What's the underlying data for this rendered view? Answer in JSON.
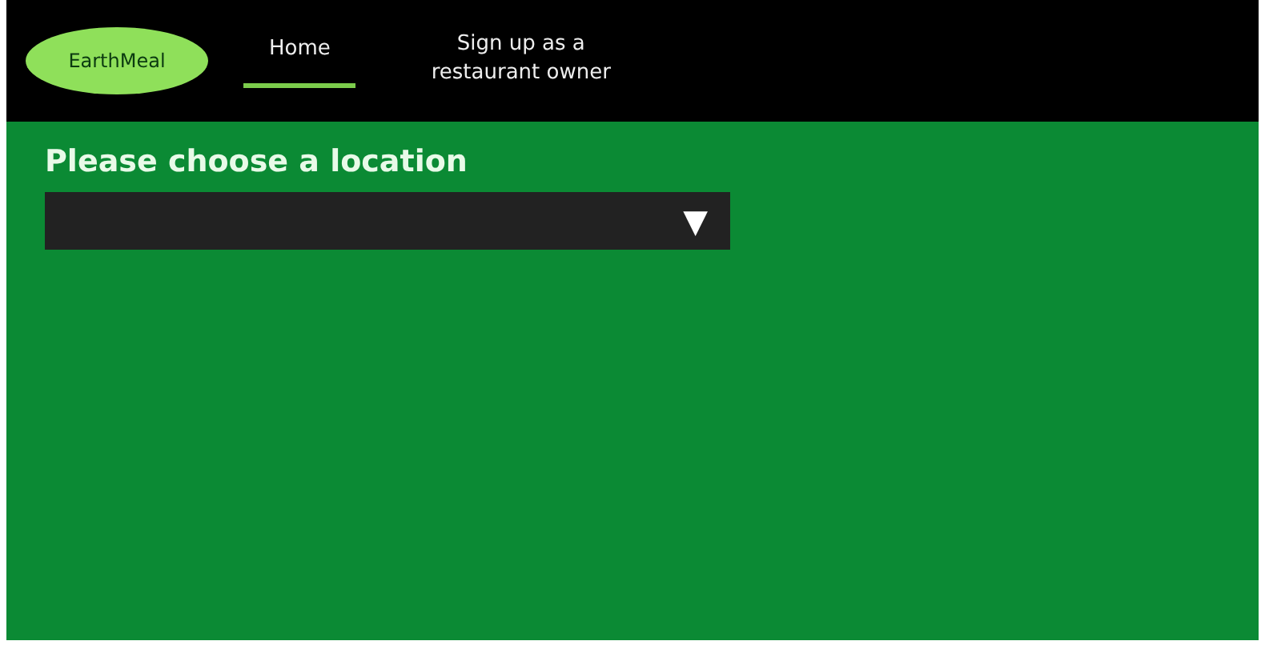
{
  "logo": {
    "text": "EarthMeal"
  },
  "nav": [
    {
      "label": "Home",
      "selected": true
    },
    {
      "label": "Sign up as a restaurant owner",
      "selected": false
    }
  ],
  "location": {
    "heading": "Please choose a location",
    "dropdown_arrow": "▼"
  }
}
